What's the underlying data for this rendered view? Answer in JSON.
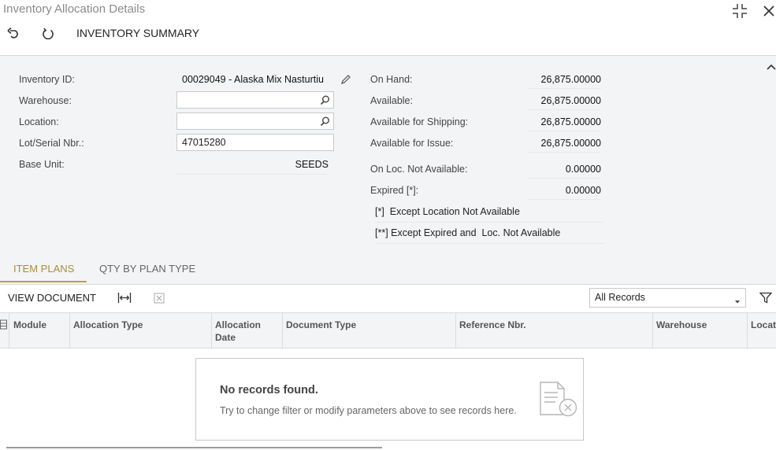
{
  "window": {
    "title": "Inventory Allocation Details",
    "toolbar_label": "INVENTORY SUMMARY"
  },
  "form": {
    "left": [
      {
        "label": "Inventory ID:",
        "value": "00029049 - Alaska Mix Nasturtiu"
      },
      {
        "label": "Warehouse:",
        "value": ""
      },
      {
        "label": "Location:",
        "value": ""
      },
      {
        "label": "Lot/Serial Nbr.:",
        "value": "47015280"
      },
      {
        "label": "Base Unit:",
        "value": "SEEDS"
      }
    ],
    "right": [
      {
        "label": "On Hand:",
        "value": "26,875.00000"
      },
      {
        "label": "Available:",
        "value": "26,875.00000"
      },
      {
        "label": "Available for Shipping:",
        "value": "26,875.00000"
      },
      {
        "label": "Available for Issue:",
        "value": "26,875.00000"
      },
      {
        "label": "On Loc. Not Available:",
        "value": "0.00000"
      },
      {
        "label": "Expired [*]:",
        "value": "0.00000"
      }
    ],
    "notes": [
      "[*]  Except Location Not Available",
      "[**] Except Expired and  Loc. Not Available"
    ]
  },
  "tabs": [
    {
      "label": "ITEM PLANS",
      "active": true
    },
    {
      "label": "QTY BY PLAN TYPE",
      "active": false
    }
  ],
  "grid": {
    "toolbar_label": "VIEW DOCUMENT",
    "filter_value": "All Records",
    "columns": [
      "Module",
      "Allocation Type",
      "Allocation Date",
      "Document Type",
      "Reference Nbr.",
      "Warehouse",
      "Locat"
    ],
    "empty_title": "No records found.",
    "empty_message": "Try to change filter or modify parameters above to see records here."
  },
  "colors": {
    "accent": "#a88f3c",
    "form_bg": "#f3f4f6"
  },
  "icons": [
    "undo-icon",
    "refresh-icon",
    "collapse-icon",
    "close-icon",
    "pencil-icon",
    "search-icon",
    "fit-columns-icon",
    "export-excel-icon",
    "filter-icon",
    "chevron-down-icon",
    "chevron-up-icon",
    "no-records-icon"
  ]
}
